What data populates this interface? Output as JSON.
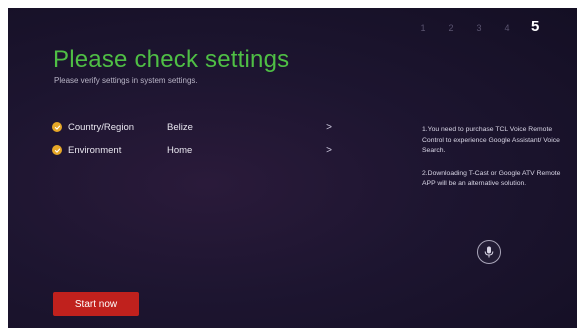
{
  "steps": [
    "1",
    "2",
    "3",
    "4",
    "5"
  ],
  "active_step": "5",
  "page": {
    "title": "Please check settings",
    "subtitle": "Please verify settings in system settings."
  },
  "settings": [
    {
      "label": "Country/Region",
      "value": "Belize",
      "icon": "check-icon"
    },
    {
      "label": "Environment",
      "value": "Home",
      "icon": "check-icon"
    }
  ],
  "chevron": ">",
  "info": {
    "line1": "1.You need to purchase TCL Voice Remote Control to experience Google Assistant/ Voice Search.",
    "line2": "2.Downloading T-Cast or Google ATV Remote APP will be an alternative solution."
  },
  "start_button": "Start now",
  "colors": {
    "title_green": "#4fbf45",
    "check_orange": "#e6a727",
    "button_red": "#c0211d",
    "background": "#1d1530"
  }
}
